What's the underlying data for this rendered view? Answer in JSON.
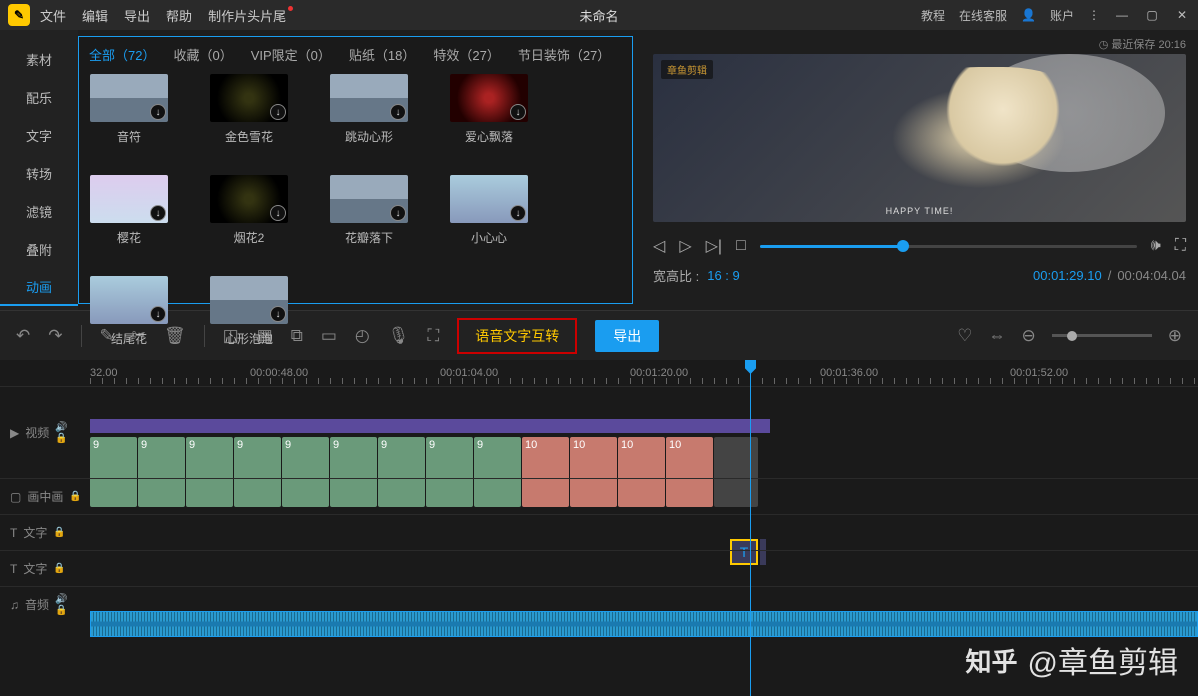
{
  "menubar": {
    "items": [
      "文件",
      "编辑",
      "导出",
      "帮助",
      "制作片头片尾"
    ],
    "title": "未命名",
    "right": {
      "tutorial": "教程",
      "service": "在线客服",
      "account": "账户"
    }
  },
  "save_status": "最近保存 20:16",
  "side_tabs": [
    "素材",
    "配乐",
    "文字",
    "转场",
    "滤镜",
    "叠附",
    "动画"
  ],
  "lib_tabs": [
    {
      "label": "全部（72）",
      "active": true
    },
    {
      "label": "收藏（0）"
    },
    {
      "label": "VIP限定（0）"
    },
    {
      "label": "贴纸（18）"
    },
    {
      "label": "特效（27）"
    },
    {
      "label": "节日装饰（27）"
    }
  ],
  "lib_items": [
    {
      "label": "音符",
      "cls": "road"
    },
    {
      "label": "金色雪花",
      "cls": "dark"
    },
    {
      "label": "跳动心形",
      "cls": "road"
    },
    {
      "label": "爱心飘落",
      "cls": "red"
    },
    {
      "label": "樱花",
      "cls": "pink"
    },
    {
      "label": "烟花2",
      "cls": "dark"
    },
    {
      "label": "花瓣落下",
      "cls": "road"
    },
    {
      "label": "小心心",
      "cls": "sky"
    },
    {
      "label": "结尾花",
      "cls": "sky"
    },
    {
      "label": "心形泡泡",
      "cls": "road"
    }
  ],
  "preview": {
    "watermark": "章鱼剪辑",
    "happytime": "HAPPY TIME!",
    "aspect_label": "宽高比 :",
    "aspect_value": "16 : 9",
    "tc_current": "00:01:29.10",
    "tc_duration": "00:04:04.04",
    "sep": "/"
  },
  "toolbar": {
    "voice_btn": "语音文字互转",
    "export_btn": "导出"
  },
  "ruler": [
    "32.00",
    "00:00:48.00",
    "00:01:04.00",
    "00:01:20.00",
    "00:01:36.00",
    "00:01:52.00"
  ],
  "tracks": {
    "video": "视频",
    "pip": "画中画",
    "text": "文字",
    "audio": "音频"
  },
  "video_clips": [
    {
      "n": "9",
      "c": "g"
    },
    {
      "n": "9",
      "c": "g"
    },
    {
      "n": "9",
      "c": "g"
    },
    {
      "n": "9",
      "c": "g"
    },
    {
      "n": "9",
      "c": "g"
    },
    {
      "n": "9",
      "c": "g"
    },
    {
      "n": "9",
      "c": "g"
    },
    {
      "n": "9",
      "c": "g"
    },
    {
      "n": "9",
      "c": "g"
    },
    {
      "n": "10",
      "c": "r"
    },
    {
      "n": "10",
      "c": "r"
    },
    {
      "n": "10",
      "c": "r"
    },
    {
      "n": "10",
      "c": "r"
    },
    {
      "n": "",
      "c": "img"
    }
  ],
  "watermark": "知乎 @章鱼剪辑"
}
